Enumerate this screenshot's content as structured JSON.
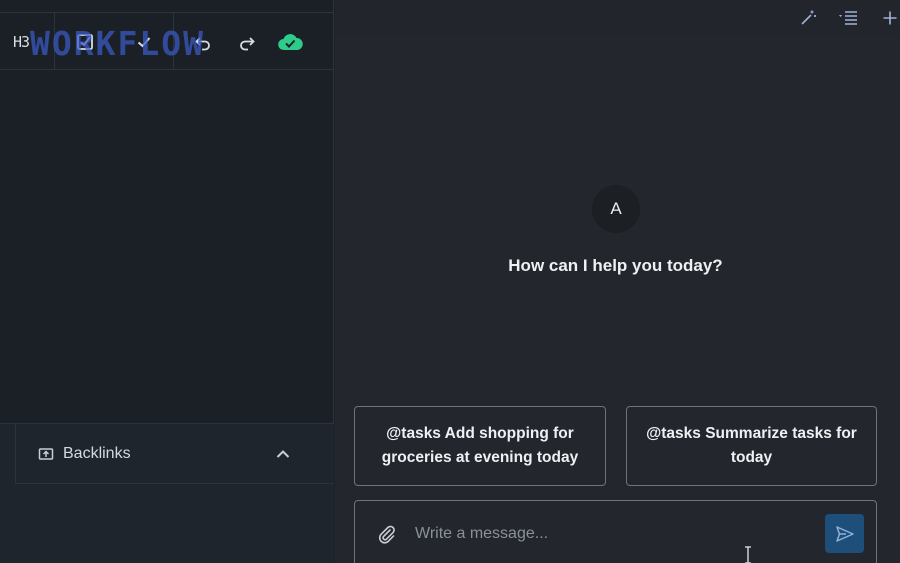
{
  "toolbar": {
    "heading_label": "H3",
    "watermark_text": "WORKFLOW"
  },
  "backlinks": {
    "label": "Backlinks"
  },
  "chat": {
    "avatar_letter": "A",
    "greeting": "How can I help you today?",
    "suggestions": [
      "@tasks Add shopping for groceries at evening today",
      "@tasks Summarize tasks for today"
    ],
    "input_placeholder": "Write a message..."
  },
  "icons": {
    "topbar": [
      "magic-wand-icon",
      "outline-list-icon",
      "plus-icon"
    ],
    "toolbar": [
      "checkbox-icon",
      "check-icon",
      "undo-icon",
      "redo-icon",
      "cloud-synced-icon"
    ],
    "composer": [
      "paperclip-icon",
      "send-icon"
    ]
  },
  "colors": {
    "cloud_synced": "#2ecc8a",
    "send_button": "#1e4f7a",
    "watermark": "#3c5ac8"
  }
}
